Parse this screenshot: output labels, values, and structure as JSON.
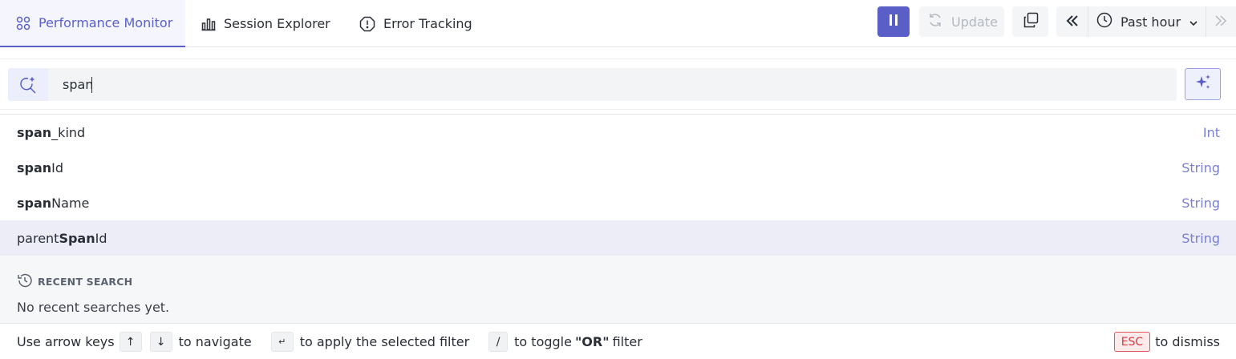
{
  "tabs": [
    {
      "label": "Performance Monitor",
      "icon": "grid-icon",
      "active": true
    },
    {
      "label": "Session Explorer",
      "icon": "bar-chart-icon",
      "active": false
    },
    {
      "label": "Error Tracking",
      "icon": "alert-octagon-icon",
      "active": false
    }
  ],
  "toolbar": {
    "update_label": "Update",
    "time_range": "Past hour"
  },
  "search": {
    "value": "span"
  },
  "suggestions": [
    {
      "pre": "",
      "match": "span",
      "post": "_kind",
      "type": "Int",
      "selected": false
    },
    {
      "pre": "",
      "match": "span",
      "post": "Id",
      "type": "String",
      "selected": false
    },
    {
      "pre": "",
      "match": "span",
      "post": "Name",
      "type": "String",
      "selected": false
    },
    {
      "pre": "parent",
      "match": "Span",
      "post": "Id",
      "type": "String",
      "selected": true
    }
  ],
  "recent": {
    "heading": "RECENT SEARCH",
    "empty_text": "No recent searches yet."
  },
  "footer": {
    "t1": "Use arrow keys",
    "k_up": "↑",
    "k_down": "↓",
    "t2": "to navigate",
    "k_enter": "↵",
    "t3": "to apply the selected filter",
    "k_slash": "/",
    "t4a": "to toggle",
    "t4b": "\"OR\"",
    "t4c": "filter",
    "k_esc": "ESC",
    "t5": "to dismiss"
  },
  "colors": {
    "accent": "#5a5fc8",
    "type_text": "#7a7fd0",
    "esc_red": "#d43a41"
  }
}
